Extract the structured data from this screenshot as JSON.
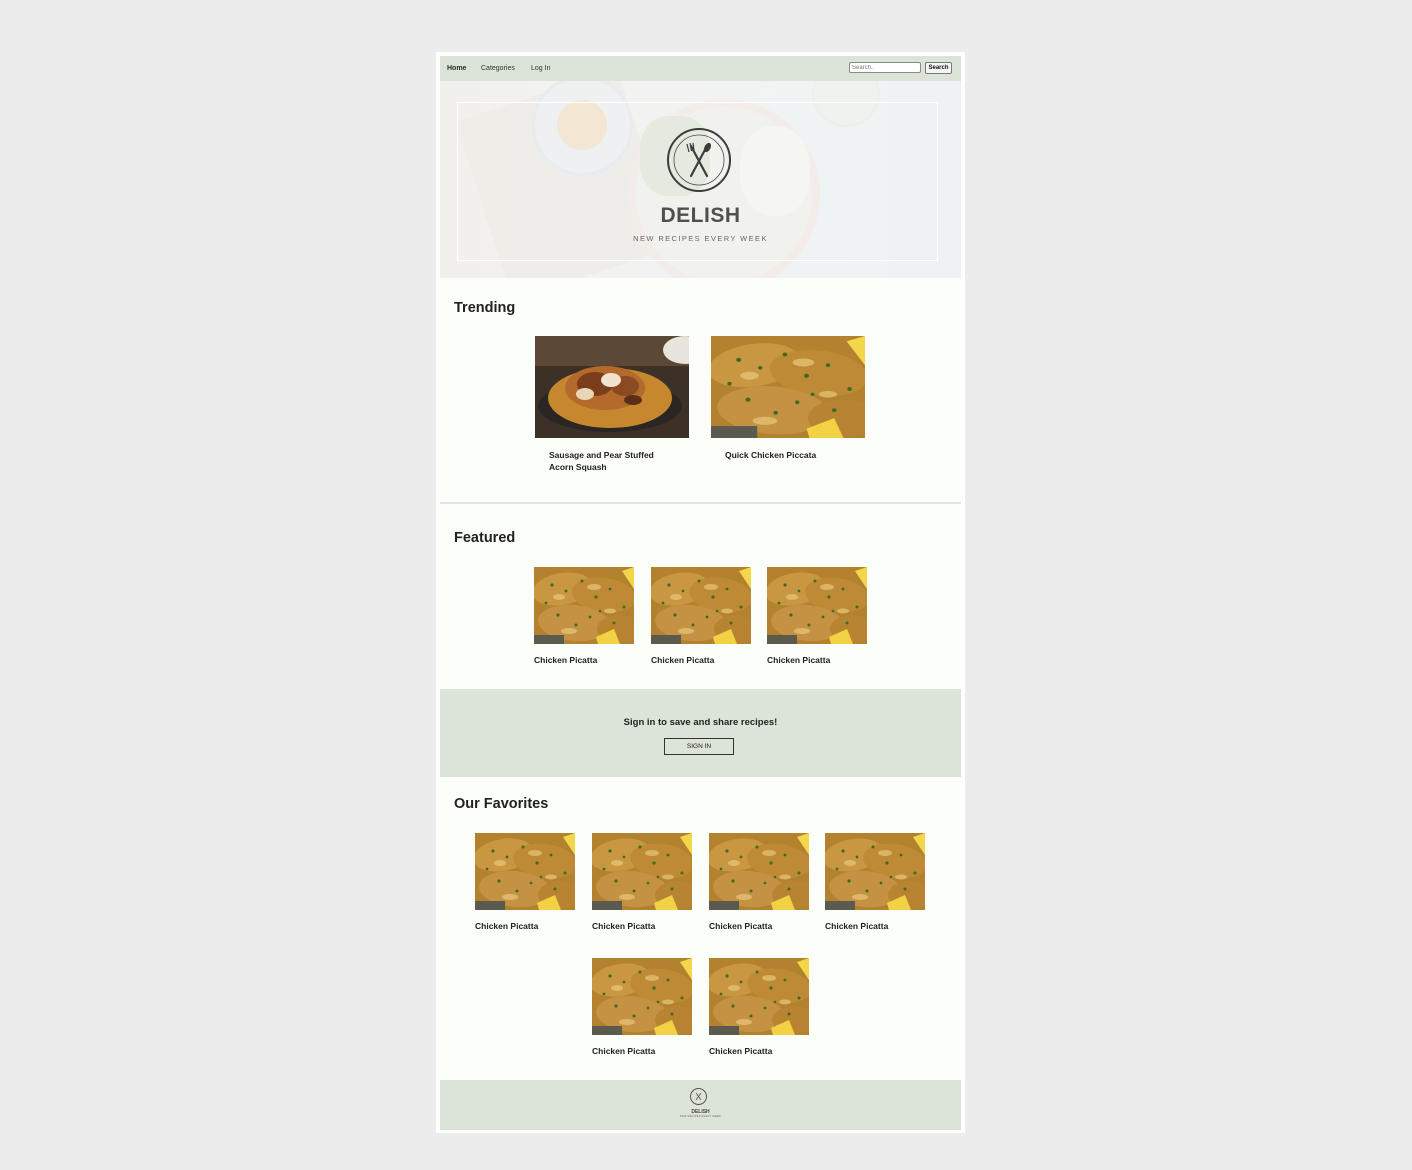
{
  "nav": {
    "links": [
      "Home",
      "Categories",
      "Log In"
    ],
    "search_placeholder": "Search..",
    "search_button": "Search"
  },
  "hero": {
    "brand": "DELISH",
    "tagline": "NEW RECIPES EVERY WEEK"
  },
  "trending": {
    "title": "Trending",
    "items": [
      {
        "label": "Sausage and Pear Stuffed Acorn Squash",
        "image": "stuffed-squash"
      },
      {
        "label": "Quick Chicken Piccata",
        "image": "chicken-piccata"
      }
    ]
  },
  "featured": {
    "title": "Featured",
    "items": [
      {
        "label": "Chicken Picatta",
        "image": "chicken-piccata"
      },
      {
        "label": "Chicken Picatta",
        "image": "chicken-piccata"
      },
      {
        "label": "Chicken Picatta",
        "image": "chicken-piccata"
      }
    ]
  },
  "signin_band": {
    "message": "Sign in to save and share recipes!",
    "button": "SIGN IN"
  },
  "favorites": {
    "title": "Our Favorites",
    "items": [
      {
        "label": "Chicken Picatta",
        "image": "chicken-piccata"
      },
      {
        "label": "Chicken Picatta",
        "image": "chicken-piccata"
      },
      {
        "label": "Chicken Picatta",
        "image": "chicken-piccata"
      },
      {
        "label": "Chicken Picatta",
        "image": "chicken-piccata"
      },
      {
        "label": "Chicken Picatta",
        "image": "chicken-piccata"
      },
      {
        "label": "Chicken Picatta",
        "image": "chicken-piccata"
      }
    ]
  },
  "footer": {
    "brand": "DELISH",
    "tagline": "NEW RECIPES EVERY WEEK"
  },
  "colors": {
    "band_green": "#dbe4d6",
    "page_bg": "#fbfef9"
  }
}
